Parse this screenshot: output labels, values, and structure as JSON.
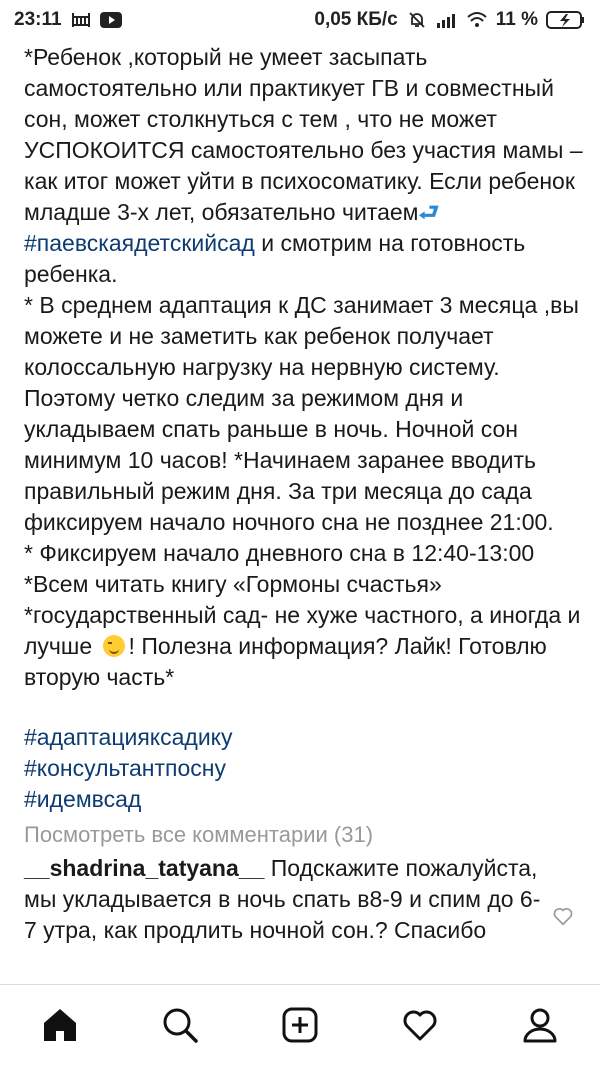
{
  "status_bar": {
    "time": "23:11",
    "network_speed": "0,05 КБ/с",
    "battery_percent": "11 %"
  },
  "post": {
    "paragraph1_a": "*Ребенок ,который не умеет засыпать самостоятельно или практикует ГВ и совместный сон, может столкнуться с тем , что не может УСПОКОИТСЯ самостоятельно без участия мамы – как итог может уйти в психосоматику. Если ребенок младше 3-х лет, обязательно читаем",
    "return_arrow": "⮐",
    "hashtag_inline": "#паевскаядетскийсад",
    "paragraph1_b": " и смотрим на готовность ребенка.",
    "paragraph2": "* В среднем адаптация к ДС занимает 3 месяца ,вы можете и не заметить как ребенок получает колоссальную нагрузку на нервную систему. Поэтому четко следим за режимом дня и укладываем спать раньше в ночь. Ночной сон минимум 10 часов! *Начинаем заранее вводить правильный режим дня. За три месяца до сада фиксируем начало ночного сна не позднее 21:00.",
    "paragraph3": "* Фиксируем начало дневного сна в 12:40-13:00",
    "paragraph4": "*Всем читать книгу «Гормоны счастья»",
    "paragraph5_a": "*государственный сад- не хуже частного, а иногда и лучше ",
    "paragraph5_b": "! Полезна информация? Лайк! Готовлю вторую часть*"
  },
  "hashtags": [
    "#адаптацияксадику",
    "#консультантпосну",
    "#идемвсад"
  ],
  "view_all_comments": "Посмотреть все комментарии (31)",
  "comment": {
    "username": "__shadrina_tatyana__",
    "text": " Подскажите пожалуйста, мы укладывается в ночь спать в8-9 и спим до 6-7 утра, как продлить ночной сон.? Спасибо"
  },
  "colors": {
    "hashtag": "#0d3c72",
    "muted": "#999999",
    "text": "#1a1a1a"
  }
}
